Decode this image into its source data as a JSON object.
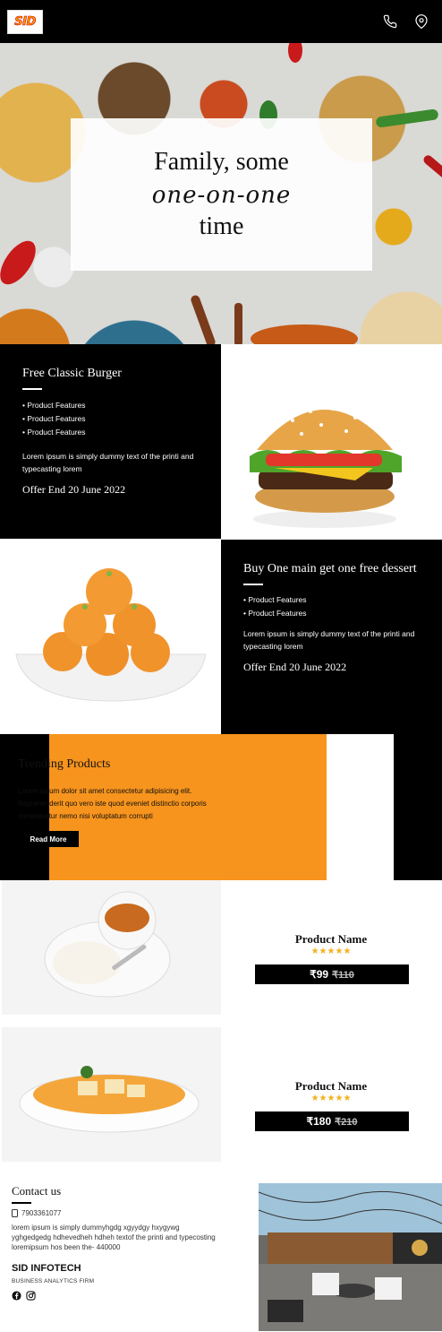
{
  "header": {
    "logo_text": "SID",
    "phone_icon": "phone-icon",
    "location_icon": "location-pin-icon",
    "background": "#000000",
    "brand_color": "#ff9a00"
  },
  "hero": {
    "line1": "Family, some",
    "line2": "one-on-one",
    "line3": "time"
  },
  "offers": [
    {
      "title": "Free Classic Burger",
      "features": [
        "• Product Features",
        "• Product Features",
        "• Product Features"
      ],
      "description": "Lorem ipsum is simply dummy text of the printi and typecasting lorem",
      "offer_end": "Offer End 20 June 2022",
      "image": "burger-image"
    },
    {
      "title": "Buy One main get one free dessert",
      "features": [
        "• Product Features",
        "• Product Features"
      ],
      "description": "Lorem ipsum is simply dummy text of the printi and typecasting lorem",
      "offer_end": "Offer End 20 June 2022",
      "image": "laddoo-image"
    }
  ],
  "trending": {
    "title": "Trending Products",
    "description": "Lorem ipsum dolor sit amet consectetur adipisicing elit. Reprehenderit quo vero iste quod eveniet distinctio corporis consequatur nemo nisi voluptatum corrupti",
    "button_label": "Read More",
    "accent": "#f7941d"
  },
  "products": [
    {
      "name": "Product Name",
      "stars": "★★★★★",
      "price": "₹99",
      "old_price": "₹110",
      "image": "curry-rice-image"
    },
    {
      "name": "Product Name",
      "stars": "★★★★★",
      "price": "₹180",
      "old_price": "₹210",
      "image": "paneer-curry-image"
    }
  ],
  "footer": {
    "title": "Contact us",
    "phone": "7903361077",
    "description": "lorem ipsum is simply dummyhgdg xgyydgy hxygywg yghgedgedg hdhevedheh hdheh textof the printi and typecosting loremipsum hos been the- 440000",
    "company": "SID INFOTECH",
    "tagline": "BUSINESS ANALYTICS FIRM",
    "social_icons": [
      "facebook-icon",
      "instagram-icon"
    ],
    "image": "restaurant-patio-image"
  }
}
